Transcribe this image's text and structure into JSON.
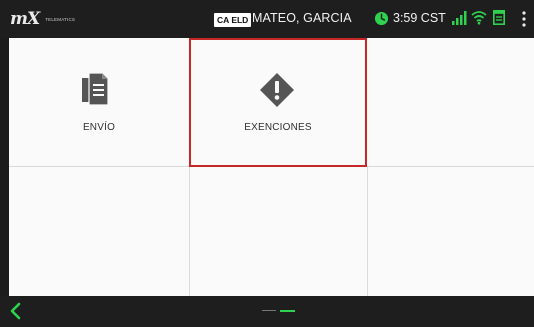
{
  "header": {
    "logo_mark": "mX",
    "logo_sub": "TELEMATICS",
    "cert_badge": "CA ELD",
    "driver_name": "MATEO, GARCIA",
    "time": "3:59 CST"
  },
  "tiles": [
    {
      "label": "ENVÍO",
      "icon": "documents-icon",
      "selected": false
    },
    {
      "label": "EXENCIONES",
      "icon": "exemption-warning-icon",
      "selected": true
    },
    {
      "label": "",
      "icon": "",
      "selected": false
    },
    {
      "label": "",
      "icon": "",
      "selected": false
    },
    {
      "label": "",
      "icon": "",
      "selected": false
    },
    {
      "label": "",
      "icon": "",
      "selected": false
    }
  ],
  "colors": {
    "accent_green": "#2fd24f",
    "selection_red": "#c62828",
    "icon_gray": "#555555",
    "bar_dark": "#1e1e1e"
  },
  "footer": {
    "back_icon": "chevron-left-icon",
    "pages": 2,
    "current_page": 2
  }
}
